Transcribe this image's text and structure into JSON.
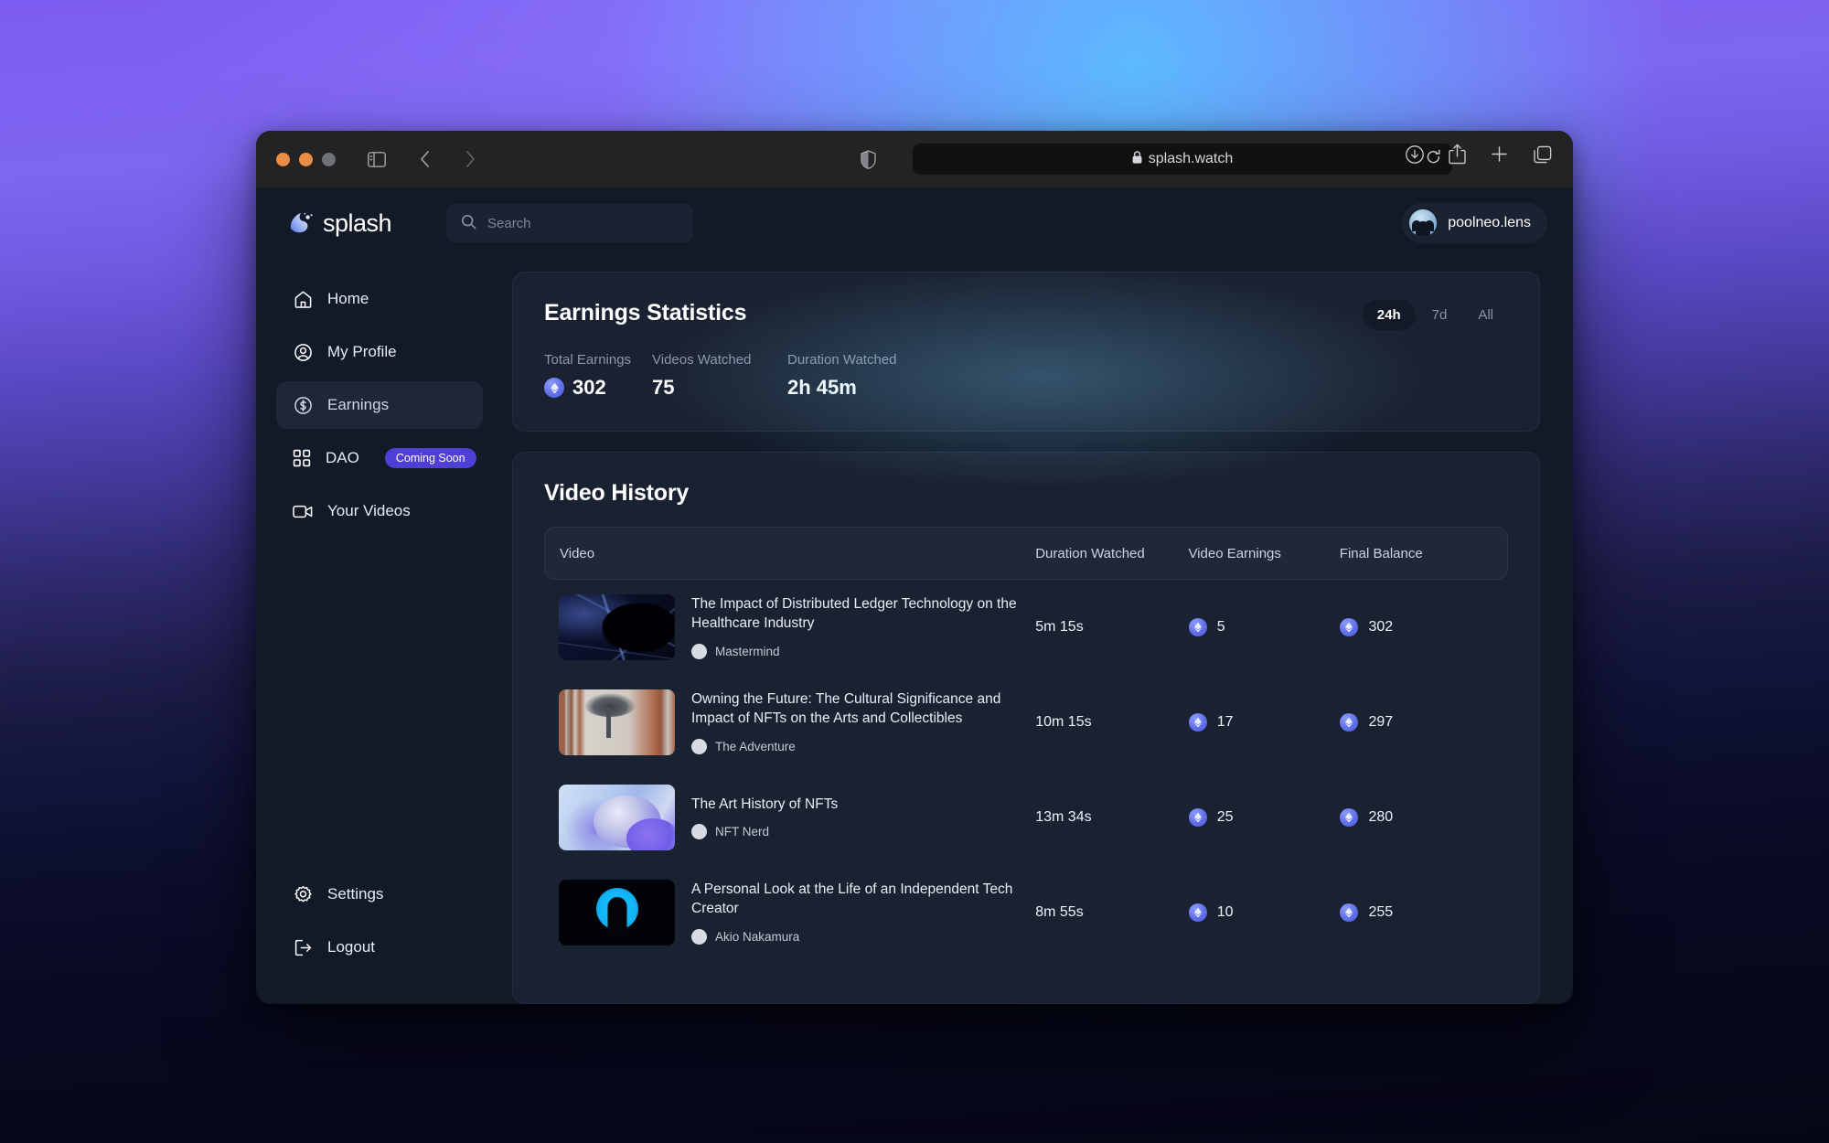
{
  "browser": {
    "url": "splash.watch",
    "lock_icon": "lock-icon",
    "traffic_lights": [
      "close",
      "minimize",
      "zoom"
    ],
    "toolbar_icons": [
      "sidebar-icon",
      "back-icon",
      "forward-icon",
      "shield-icon",
      "reload-icon",
      "download-icon",
      "share-icon",
      "new-tab-icon",
      "tab-overview-icon"
    ]
  },
  "app": {
    "brand": "splash",
    "search": {
      "placeholder": "Search",
      "value": ""
    },
    "user": {
      "handle": "poolneo.lens"
    }
  },
  "sidebar": {
    "items": [
      {
        "label": "Home",
        "icon": "home-icon",
        "active": false
      },
      {
        "label": "My Profile",
        "icon": "user-circle-icon",
        "active": false
      },
      {
        "label": "Earnings",
        "icon": "dollar-coin-icon",
        "active": true
      },
      {
        "label": "DAO",
        "icon": "grid-icon",
        "active": false,
        "badge": "Coming Soon"
      },
      {
        "label": "Your Videos",
        "icon": "video-camera-icon",
        "active": false
      }
    ],
    "footer": [
      {
        "label": "Settings",
        "icon": "gear-icon"
      },
      {
        "label": "Logout",
        "icon": "logout-icon"
      }
    ]
  },
  "stats": {
    "title": "Earnings Statistics",
    "range_options": [
      {
        "label": "24h",
        "selected": true
      },
      {
        "label": "7d",
        "selected": false
      },
      {
        "label": "All",
        "selected": false
      }
    ],
    "metrics": [
      {
        "label": "Total Earnings",
        "value": "302",
        "coin": true
      },
      {
        "label": "Videos Watched",
        "value": "75",
        "coin": false
      },
      {
        "label": "Duration Watched",
        "value": "2h 45m",
        "coin": false
      }
    ]
  },
  "history": {
    "title": "Video History",
    "columns": [
      "Video",
      "Duration Watched",
      "Video Earnings",
      "Final Balance"
    ],
    "rows": [
      {
        "title": "The Impact of Distributed Ledger Technology on the Healthcare Industry",
        "channel": "Mastermind",
        "duration": "5m 15s",
        "earnings": "5",
        "balance": "302",
        "thumb": "art-web"
      },
      {
        "title": "Owning the Future: The Cultural Significance and Impact of NFTs on the Arts and Collectibles",
        "channel": "The Adventure",
        "duration": "10m 15s",
        "earnings": "17",
        "balance": "297",
        "thumb": "art-desert"
      },
      {
        "title": "The Art History of NFTs",
        "channel": "NFT Nerd",
        "duration": "13m 34s",
        "earnings": "25",
        "balance": "280",
        "thumb": "art-ball"
      },
      {
        "title": "A Personal Look at the Life of an Independent Tech Creator",
        "channel": "Akio Nakamura",
        "duration": "8m 55s",
        "earnings": "10",
        "balance": "255",
        "thumb": "art-person"
      }
    ]
  },
  "colors": {
    "accent": "#4f3fd6",
    "coin": "#6474ee",
    "card": "#1a2232",
    "app_bg": "#121a28",
    "active_nav": "#1e2637"
  }
}
